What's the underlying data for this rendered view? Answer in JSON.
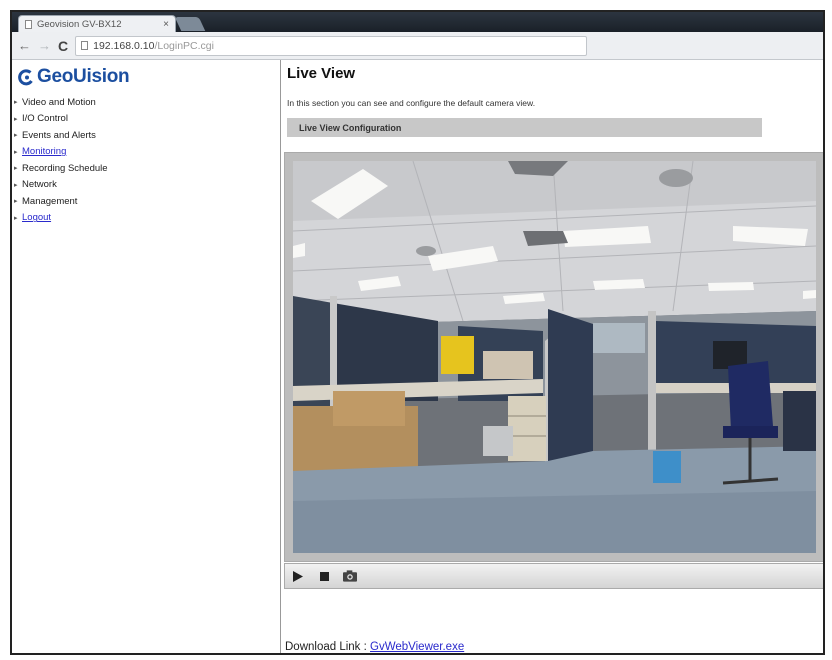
{
  "browser": {
    "tab_title": "Geovision GV-BX12",
    "tab_close": "×",
    "url_host": "192.168.0.10",
    "url_path": "/LoginPC.cgi",
    "back_glyph": "←",
    "forward_glyph": "→",
    "reload_glyph": "C"
  },
  "sidebar": {
    "logo_text": "GeoUision",
    "items": [
      {
        "label": "Video and Motion",
        "link": false
      },
      {
        "label": "I/O Control",
        "link": false
      },
      {
        "label": "Events and Alerts",
        "link": false
      },
      {
        "label": "Monitoring",
        "link": true
      },
      {
        "label": "Recording Schedule",
        "link": false
      },
      {
        "label": "Network",
        "link": false
      },
      {
        "label": "Management",
        "link": false
      },
      {
        "label": "Logout",
        "link": true
      }
    ]
  },
  "main": {
    "title": "Live View",
    "intro": "In this section you can see and configure the default camera view.",
    "section_header": "Live View Configuration",
    "controls": [
      "play-icon",
      "stop-icon",
      "snapshot-icon"
    ],
    "download_label": "Download Link : ",
    "download_link": "GvWebViewer.exe"
  },
  "colors": {
    "link": "#2a2acc",
    "logo": "#1c4fa0",
    "section_bar": "#c8c8c8"
  }
}
